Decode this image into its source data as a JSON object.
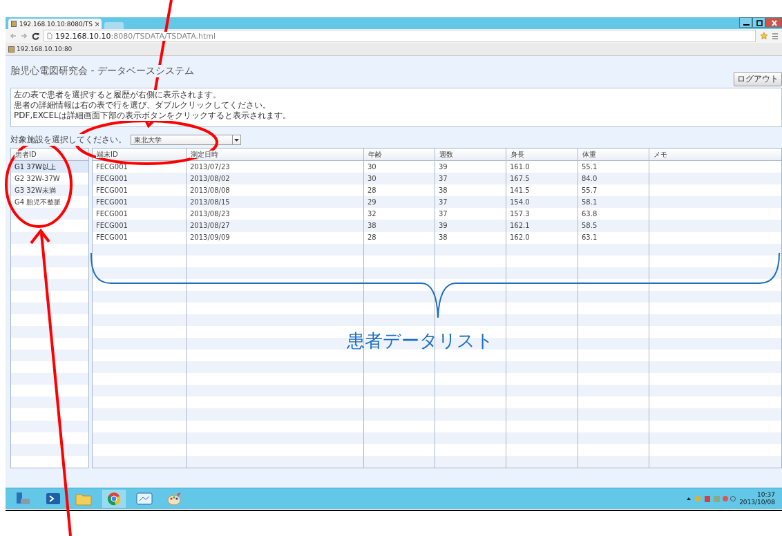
{
  "browser": {
    "tab_title": "192.168.10.10:8080/TS",
    "url_host": "192.168.10.10",
    "url_rest": ":8080/TSDATA/TSDATA.html",
    "bookmark": "192.168.10.10:80"
  },
  "page": {
    "title": "胎児心電図研究会 - データベースシステム",
    "logout": "ログアウト",
    "info_lines": [
      "左の表で患者を選択すると履歴が右側に表示されます。",
      "患者の詳細情報は右の表で行を選び、ダブルクリックしてください。",
      "PDF,EXCELは詳細画面下部の表示ボタンをクリックすると表示されます。"
    ],
    "facility_label": "対象施設を選択してください。",
    "facility_value": "東北大学",
    "groups": {
      "column": "患者ID",
      "items": [
        {
          "label": "G1 37W以上",
          "selected": true
        },
        {
          "label": "G2 32W-37W",
          "selected": false
        },
        {
          "label": "G3 32W未満",
          "selected": false
        },
        {
          "label": "G4 胎児不整脈",
          "selected": false
        }
      ]
    },
    "table": {
      "columns": [
        "端末ID",
        "測定日時",
        "年齢",
        "週数",
        "身長",
        "体重",
        "メモ"
      ],
      "rows": [
        [
          "FECG001",
          "2013/07/23",
          "30",
          "39",
          "161.0",
          "55.1",
          ""
        ],
        [
          "FECG001",
          "2013/08/02",
          "30",
          "37",
          "167.5",
          "84.0",
          ""
        ],
        [
          "FECG001",
          "2013/08/08",
          "28",
          "38",
          "141.5",
          "55.7",
          ""
        ],
        [
          "FECG001",
          "2013/08/15",
          "29",
          "37",
          "154.0",
          "58.1",
          ""
        ],
        [
          "FECG001",
          "2013/08/23",
          "32",
          "37",
          "157.3",
          "63.8",
          ""
        ],
        [
          "FECG001",
          "2013/08/27",
          "38",
          "39",
          "162.1",
          "58.5",
          ""
        ],
        [
          "FECG001",
          "2013/09/09",
          "28",
          "38",
          "162.0",
          "63.1",
          ""
        ]
      ]
    }
  },
  "taskbar": {
    "time": "10:37",
    "date": "2013/10/08"
  },
  "annotation": {
    "label": "患者データリスト"
  }
}
